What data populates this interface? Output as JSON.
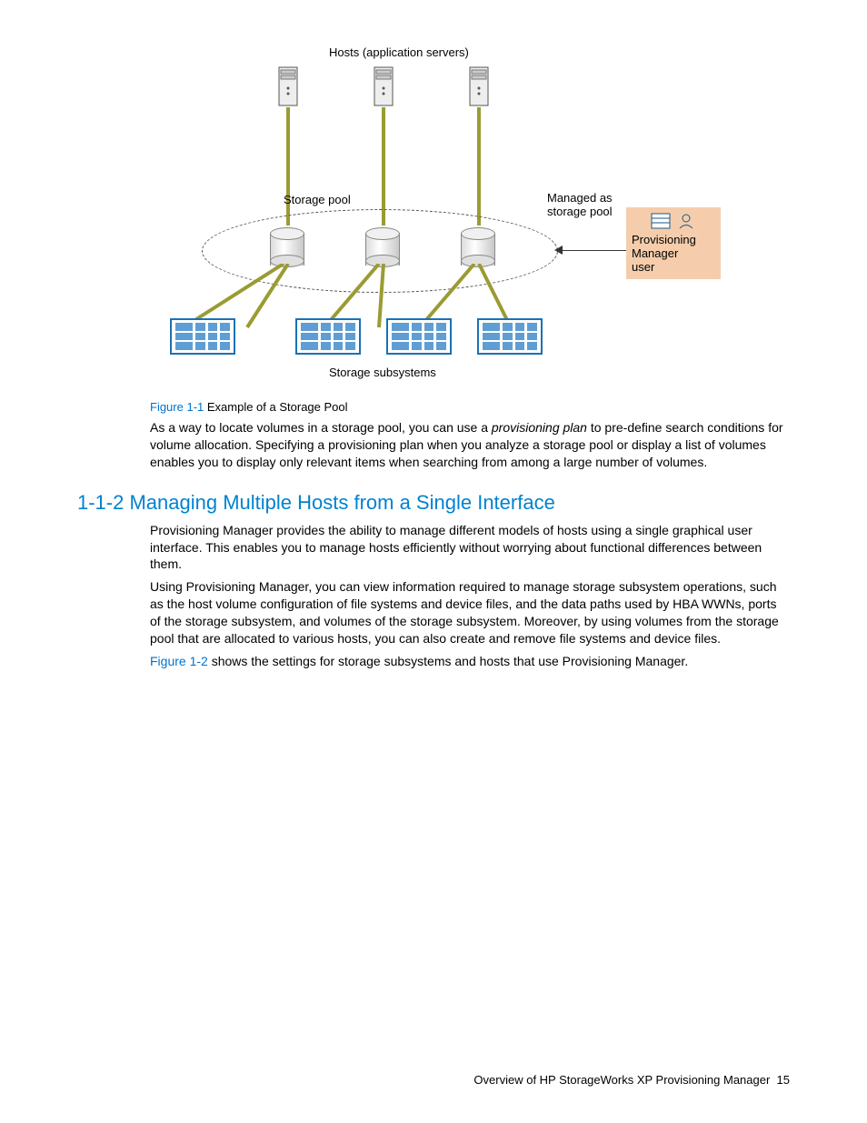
{
  "diagram": {
    "hosts_label": "Hosts (application servers)",
    "storage_pool_label": "Storage pool",
    "managed_as_label": "Managed as\nstorage pool",
    "storage_subsystems_label": "Storage subsystems",
    "user_box_line1": "Provisioning",
    "user_box_line2": "Manager",
    "user_box_line3": "user"
  },
  "figure_caption": {
    "ref": "Figure 1-1",
    "text": " Example of a Storage Pool"
  },
  "paragraph_1a": "As a way to locate volumes in a storage pool, you can use a ",
  "paragraph_1_em": "provisioning plan",
  "paragraph_1b": " to pre-define search conditions for volume allocation. Specifying a provisioning plan when you analyze a storage pool or display a list of volumes enables you to display only relevant items when searching from among a large number of volumes.",
  "section_heading": "1-1-2 Managing Multiple Hosts from a Single Interface",
  "paragraph_2": "Provisioning Manager provides the ability to manage different models of hosts using a single graphical user interface. This enables you to manage hosts efficiently without worrying about functional differences between them.",
  "paragraph_3": "Using Provisioning Manager, you can view information required to manage storage subsystem operations, such as the host volume configuration of file systems and device files, and the data paths used by HBA WWNs, ports of the storage subsystem, and volumes of the storage subsystem. Moreover, by using volumes from the storage pool that are allocated to various hosts, you can also create and remove file systems and device files.",
  "paragraph_4_ref": "Figure 1-2",
  "paragraph_4_text": " shows the settings for storage subsystems and hosts that use Provisioning Manager.",
  "footer": {
    "text": "Overview of HP StorageWorks XP Provisioning Manager",
    "page": "15"
  }
}
